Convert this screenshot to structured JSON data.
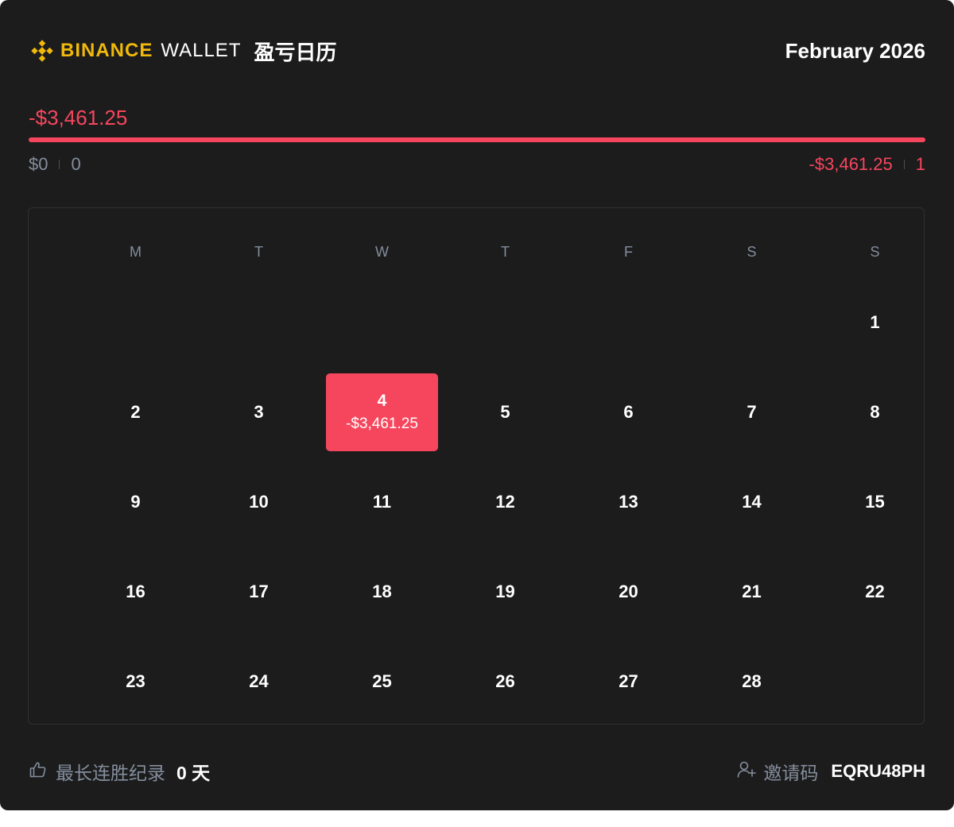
{
  "header": {
    "brand_binance": "BINANCE",
    "brand_wallet": "WALLET",
    "title": "盈亏日历",
    "month": "February 2026"
  },
  "summary": {
    "total_pnl": "-$3,461.25",
    "profit_amount": "$0",
    "profit_days": "0",
    "loss_amount": "-$3,461.25",
    "loss_days": "1",
    "loss_share_percent": 100
  },
  "calendar": {
    "weekdays": [
      "M",
      "T",
      "W",
      "T",
      "F",
      "S",
      "S"
    ],
    "first_weekday_index": 6,
    "days": [
      {
        "day": "1"
      },
      {
        "day": "2"
      },
      {
        "day": "3"
      },
      {
        "day": "4",
        "pnl": "-$3,461.25",
        "status": "loss"
      },
      {
        "day": "5"
      },
      {
        "day": "6"
      },
      {
        "day": "7"
      },
      {
        "day": "8"
      },
      {
        "day": "9"
      },
      {
        "day": "10"
      },
      {
        "day": "11"
      },
      {
        "day": "12"
      },
      {
        "day": "13"
      },
      {
        "day": "14"
      },
      {
        "day": "15"
      },
      {
        "day": "16"
      },
      {
        "day": "17"
      },
      {
        "day": "18"
      },
      {
        "day": "19"
      },
      {
        "day": "20"
      },
      {
        "day": "21"
      },
      {
        "day": "22"
      },
      {
        "day": "23"
      },
      {
        "day": "24"
      },
      {
        "day": "25"
      },
      {
        "day": "26"
      },
      {
        "day": "27"
      },
      {
        "day": "28"
      }
    ]
  },
  "footer": {
    "streak_label": "最长连胜纪录",
    "streak_value": "0 天",
    "invite_label": "邀请码",
    "invite_code": "EQRU48PH",
    "icons": [
      "thumbs-up-icon",
      "add-user-icon"
    ]
  },
  "colors": {
    "background": "#1c1c1d",
    "brand": "#f0b90b",
    "loss": "#f6465d",
    "muted": "#848e9c"
  }
}
